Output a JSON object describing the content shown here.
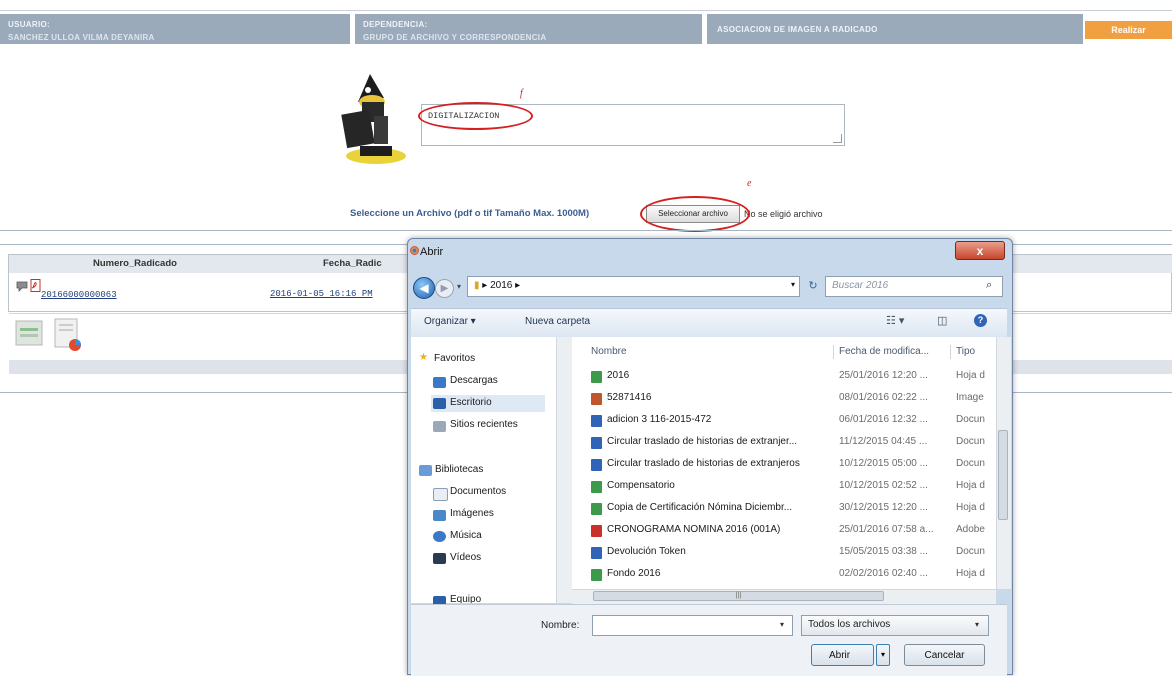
{
  "header": {
    "usuario_label": "USUARIO:",
    "usuario_value": "SANCHEZ ULLOA VILMA DEYANIRA",
    "dependencia_label": "DEPENDENCIA:",
    "dependencia_value": "GRUPO DE ARCHIVO Y CORRESPONDENCIA",
    "section_title": "ASOCIACION DE IMAGEN A RADICADO",
    "realizar_label": "Realizar"
  },
  "form": {
    "description_value": "DIGITALIZACION",
    "annotation_1": "f",
    "annotation_2": "e",
    "select_file_label": "Seleccione un Archivo (pdf o tif Tamaño Max. 1000M)",
    "file_button_label": "Seleccionar archivo",
    "no_file_text": "No se eligió archivo"
  },
  "results": {
    "col_numero": "Numero_Radicado",
    "col_fecha": "Fecha_Radic",
    "rows": [
      {
        "numero": "20166000000063",
        "fecha": "2016-01-05 16:16 PM"
      }
    ]
  },
  "dialog": {
    "title": "Abrir",
    "close_label": "x",
    "address_path": "2016",
    "search_placeholder": "Buscar 2016",
    "organize_label": "Organizar ▾",
    "new_folder_label": "Nueva carpeta",
    "nav_pane": {
      "favorites_header": "Favoritos",
      "favorites": [
        "Descargas",
        "Escritorio",
        "Sitios recientes"
      ],
      "libraries_header": "Bibliotecas",
      "libraries": [
        "Documentos",
        "Imágenes",
        "Música",
        "Vídeos"
      ],
      "last_item": "Equipo"
    },
    "columns": {
      "name": "Nombre",
      "date": "Fecha de modifica...",
      "type": "Tipo"
    },
    "files": [
      {
        "name": "2016",
        "date": "25/01/2016 12:20 ...",
        "type": "Hoja d",
        "icon": "excel-icon",
        "color": "#3c9a4a"
      },
      {
        "name": "52871416",
        "date": "08/01/2016 02:22 ...",
        "type": "Image",
        "icon": "image-icon",
        "color": "#c0562c"
      },
      {
        "name": "adicion 3  116-2015-472",
        "date": "06/01/2016 12:32 ...",
        "type": "Docun",
        "icon": "word-icon",
        "color": "#2f64b8"
      },
      {
        "name": "Circular traslado de historias de extranjer...",
        "date": "11/12/2015 04:45 ...",
        "type": "Docun",
        "icon": "word-icon",
        "color": "#2f64b8"
      },
      {
        "name": "Circular traslado de historias de extranjeros",
        "date": "10/12/2015 05:00 ...",
        "type": "Docun",
        "icon": "word-icon",
        "color": "#2f64b8"
      },
      {
        "name": "Compensatorio",
        "date": "10/12/2015 02:52 ...",
        "type": "Hoja d",
        "icon": "excel-icon",
        "color": "#3c9a4a"
      },
      {
        "name": "Copia de Certificación Nómina Diciembr...",
        "date": "30/12/2015 12:20 ...",
        "type": "Hoja d",
        "icon": "excel-icon",
        "color": "#3c9a4a"
      },
      {
        "name": "CRONOGRAMA NOMINA 2016 (001A)",
        "date": "25/01/2016 07:58 a...",
        "type": "Adobe",
        "icon": "pdf-icon",
        "color": "#c8322a"
      },
      {
        "name": "Devolución Token",
        "date": "15/05/2015 03:38 ...",
        "type": "Docun",
        "icon": "word-icon",
        "color": "#2f64b8"
      },
      {
        "name": "Fondo 2016",
        "date": "02/02/2016 02:40 ...",
        "type": "Hoja d",
        "icon": "excel-icon",
        "color": "#3c9a4a"
      }
    ],
    "filename_label": "Nombre:",
    "filename_value": "",
    "filter_value": "Todos los archivos",
    "open_label": "Abrir",
    "cancel_label": "Cancelar"
  }
}
